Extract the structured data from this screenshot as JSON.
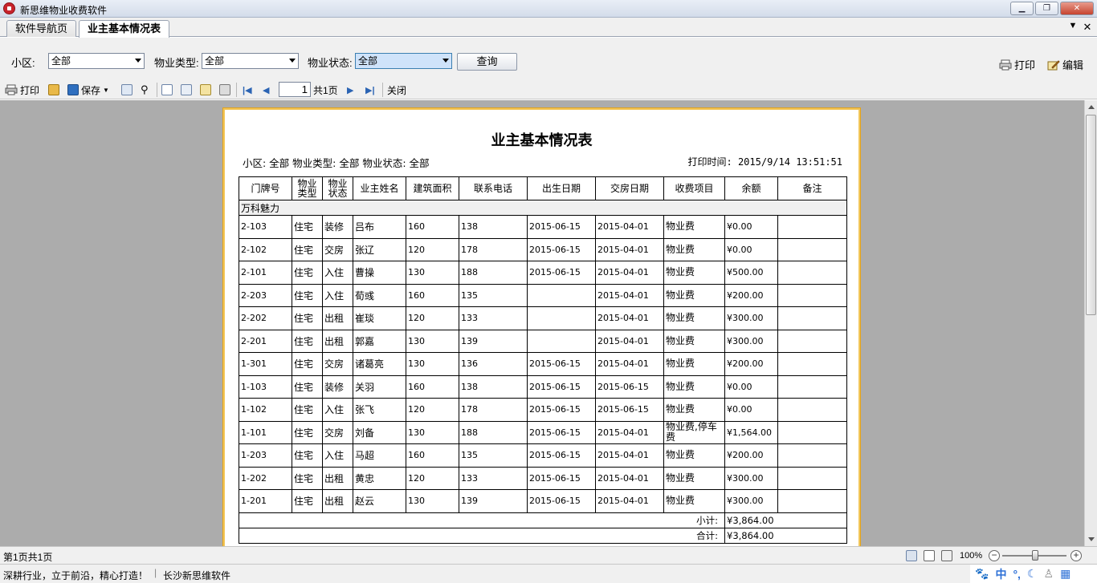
{
  "window": {
    "title": "新思维物业收费软件"
  },
  "tabs": [
    {
      "label": "软件导航页"
    },
    {
      "label": "业主基本情况表"
    }
  ],
  "filters": {
    "area_label": "小区:",
    "area_value": "全部",
    "type_label": "物业类型:",
    "type_value": "全部",
    "status_label": "物业状态:",
    "status_value": "全部",
    "query_button": "查询"
  },
  "right_tools": {
    "print": "打印",
    "edit": "编辑"
  },
  "toolbar": {
    "print": "打印",
    "save": "保存",
    "page_value": "1",
    "page_total": "共1页",
    "close": "关闭"
  },
  "report": {
    "title": "业主基本情况表",
    "filter_line": "小区: 全部   物业类型: 全部   物业状态: 全部",
    "print_time": "打印时间: 2015/9/14 13:51:51",
    "columns": [
      "门牌号",
      "物业类型",
      "物业状态",
      "业主姓名",
      "建筑面积",
      "联系电话",
      "出生日期",
      "交房日期",
      "收费项目",
      "余额",
      "备注"
    ],
    "group": "万科魅力",
    "rows": [
      [
        "2-103",
        "住宅",
        "装修",
        "吕布",
        "160",
        "138",
        "2015-06-15",
        "2015-04-01",
        "物业费",
        "¥0.00",
        ""
      ],
      [
        "2-102",
        "住宅",
        "交房",
        "张辽",
        "120",
        "178",
        "2015-06-15",
        "2015-04-01",
        "物业费",
        "¥0.00",
        ""
      ],
      [
        "2-101",
        "住宅",
        "入住",
        "曹操",
        "130",
        "188",
        "2015-06-15",
        "2015-04-01",
        "物业费",
        "¥500.00",
        ""
      ],
      [
        "2-203",
        "住宅",
        "入住",
        "荀彧",
        "160",
        "135",
        "",
        "2015-04-01",
        "物业费",
        "¥200.00",
        ""
      ],
      [
        "2-202",
        "住宅",
        "出租",
        "崔琰",
        "120",
        "133",
        "",
        "2015-04-01",
        "物业费",
        "¥300.00",
        ""
      ],
      [
        "2-201",
        "住宅",
        "出租",
        "郭嘉",
        "130",
        "139",
        "",
        "2015-04-01",
        "物业费",
        "¥300.00",
        ""
      ],
      [
        "1-301",
        "住宅",
        "交房",
        "诸葛亮",
        "130",
        "136",
        "2015-06-15",
        "2015-04-01",
        "物业费",
        "¥200.00",
        ""
      ],
      [
        "1-103",
        "住宅",
        "装修",
        "关羽",
        "160",
        "138",
        "2015-06-15",
        "2015-06-15",
        "物业费",
        "¥0.00",
        ""
      ],
      [
        "1-102",
        "住宅",
        "入住",
        "张飞",
        "120",
        "178",
        "2015-06-15",
        "2015-06-15",
        "物业费",
        "¥0.00",
        ""
      ],
      [
        "1-101",
        "住宅",
        "交房",
        "刘备",
        "130",
        "188",
        "2015-06-15",
        "2015-04-01",
        "物业费,停车费",
        "¥1,564.00",
        ""
      ],
      [
        "1-203",
        "住宅",
        "入住",
        "马超",
        "160",
        "135",
        "2015-06-15",
        "2015-04-01",
        "物业费",
        "¥200.00",
        ""
      ],
      [
        "1-202",
        "住宅",
        "出租",
        "黄忠",
        "120",
        "133",
        "2015-06-15",
        "2015-04-01",
        "物业费",
        "¥300.00",
        ""
      ],
      [
        "1-201",
        "住宅",
        "出租",
        "赵云",
        "130",
        "139",
        "2015-06-15",
        "2015-04-01",
        "物业费",
        "¥300.00",
        ""
      ]
    ],
    "subtotal_label": "小计:",
    "subtotal_value": "¥3,864.00",
    "total_label": "合计:",
    "total_value": "¥3,864.00"
  },
  "status": {
    "page_info": "第1页共1页",
    "zoom": "100%"
  },
  "bottom": {
    "slogan": "深耕行业，立于前沿，精心打造！",
    "company": "长沙新思维软件"
  },
  "ime": {
    "mode": "中"
  }
}
